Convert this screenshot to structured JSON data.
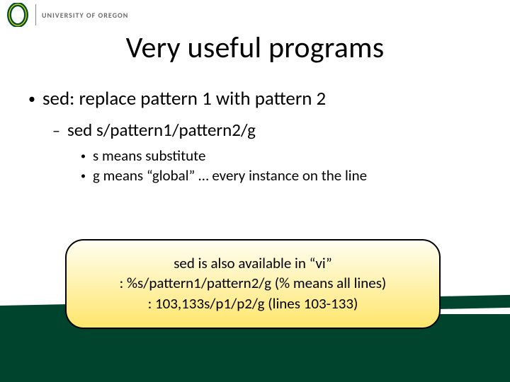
{
  "header": {
    "university": "UNIVERSITY OF OREGON"
  },
  "title": "Very useful programs",
  "bullets": {
    "lvl1": "sed: replace pattern 1 with pattern 2",
    "lvl2": "sed s/pattern1/pattern2/g",
    "lvl3a": "s means substitute",
    "lvl3b": "g means “global” … every instance on the line"
  },
  "callout": {
    "line1": "sed is also available in “vi”",
    "line2": ": %s/pattern1/pattern2/g  (% means all lines)",
    "line3": ": 103,133s/p1/p2/g (lines 103-133)"
  }
}
